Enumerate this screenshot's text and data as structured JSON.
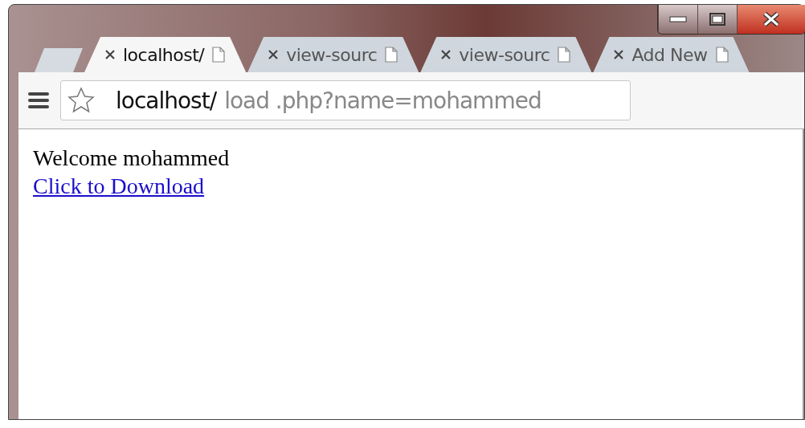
{
  "tabs": [
    {
      "title": "localhost/",
      "selected": true
    },
    {
      "title": "view-sourc",
      "selected": false
    },
    {
      "title": "view-sourc",
      "selected": false
    },
    {
      "title": "Add New",
      "selected": false
    }
  ],
  "address_bar": {
    "host": "localhost/",
    "path": "load .php?name=mohammed"
  },
  "page": {
    "greeting": "Welcome mohammed",
    "link": "Click to Download"
  }
}
